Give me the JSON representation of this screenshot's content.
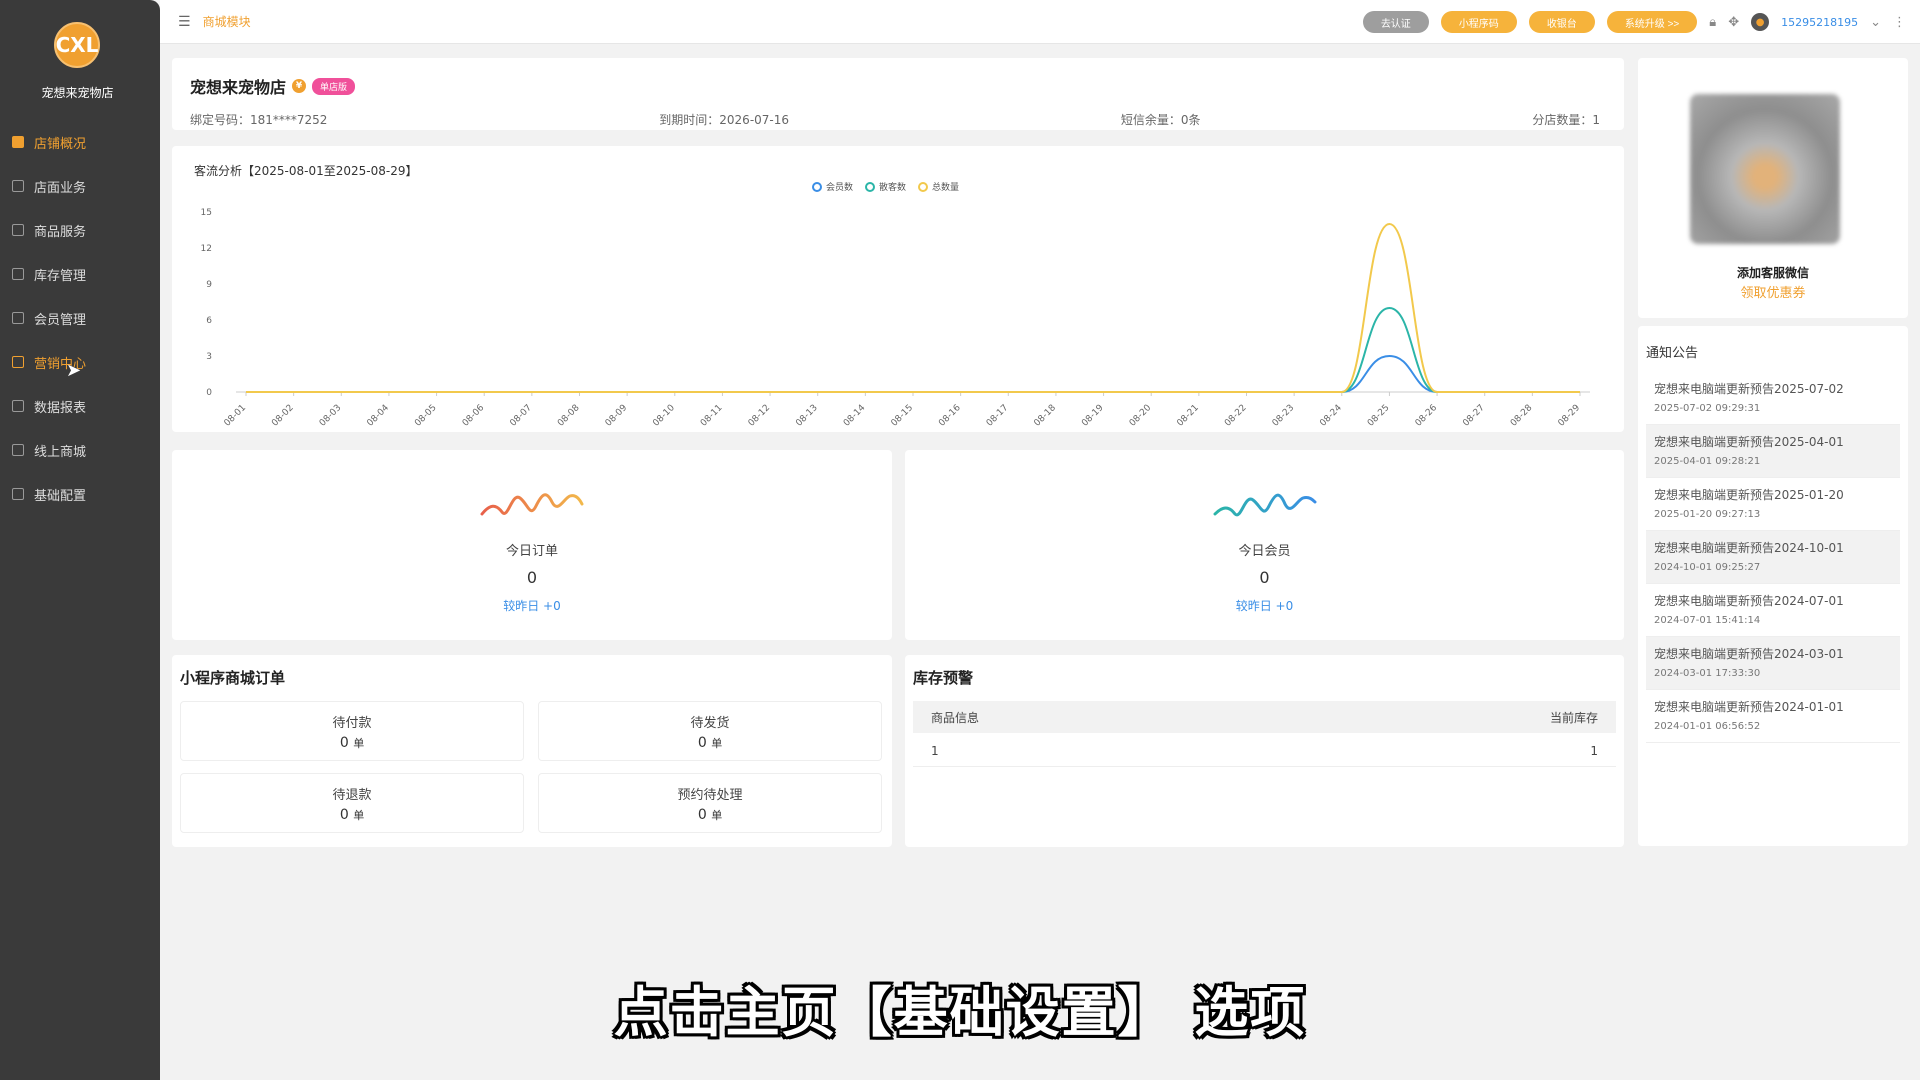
{
  "sidebar": {
    "logo_text": "CXL",
    "store_name": "宠想来宠物店",
    "items": [
      {
        "label": "店铺概况",
        "icon": "store-icon"
      },
      {
        "label": "店面业务",
        "icon": "shop-icon"
      },
      {
        "label": "商品服务",
        "icon": "goods-icon"
      },
      {
        "label": "库存管理",
        "icon": "inventory-icon"
      },
      {
        "label": "会员管理",
        "icon": "member-icon"
      },
      {
        "label": "营销中心",
        "icon": "marketing-icon"
      },
      {
        "label": "数据报表",
        "icon": "report-icon"
      },
      {
        "label": "线上商城",
        "icon": "mall-icon"
      },
      {
        "label": "基础配置",
        "icon": "config-icon"
      }
    ],
    "active_index": 0,
    "hover_index": 5
  },
  "topbar": {
    "module_link": "商城模块",
    "buttons": [
      "去认证",
      "小程序码",
      "收银台",
      "系统升级 >>"
    ],
    "phone": "15295218195"
  },
  "store": {
    "name": "宠想来宠物店",
    "badge": "单店版",
    "bind_phone": "绑定号码：181****7252",
    "expire": "到期时间：2026-07-16",
    "sms": "短信余量：0条",
    "branches": "分店数量：1"
  },
  "chart_data": {
    "type": "line",
    "title": "客流分析【2025-08-01至2025-08-29】",
    "categories": [
      "08-01",
      "08-02",
      "08-03",
      "08-04",
      "08-05",
      "08-06",
      "08-07",
      "08-08",
      "08-09",
      "08-10",
      "08-11",
      "08-12",
      "08-13",
      "08-14",
      "08-15",
      "08-16",
      "08-17",
      "08-18",
      "08-19",
      "08-20",
      "08-21",
      "08-22",
      "08-23",
      "08-24",
      "08-25",
      "08-26",
      "08-27",
      "08-28",
      "08-29"
    ],
    "series": [
      {
        "name": "会员数",
        "color": "#3a8ee6",
        "values": [
          0,
          0,
          0,
          0,
          0,
          0,
          0,
          0,
          0,
          0,
          0,
          0,
          0,
          0,
          0,
          0,
          0,
          0,
          0,
          0,
          0,
          0,
          0,
          0,
          3,
          0,
          0,
          0,
          0
        ]
      },
      {
        "name": "散客数",
        "color": "#2bb5a8",
        "values": [
          0,
          0,
          0,
          0,
          0,
          0,
          0,
          0,
          0,
          0,
          0,
          0,
          0,
          0,
          0,
          0,
          0,
          0,
          0,
          0,
          0,
          0,
          0,
          0,
          7,
          0,
          0,
          0,
          0
        ]
      },
      {
        "name": "总数量",
        "color": "#f2c94c",
        "values": [
          0,
          0,
          0,
          0,
          0,
          0,
          0,
          0,
          0,
          0,
          0,
          0,
          0,
          0,
          0,
          0,
          0,
          0,
          0,
          0,
          0,
          0,
          0,
          0,
          14,
          0,
          0,
          0,
          0
        ]
      }
    ],
    "y_ticks": [
      "0",
      "3",
      "6",
      "9",
      "12",
      "15"
    ],
    "ylim": [
      0,
      15
    ],
    "grid": false,
    "legend": "top-center"
  },
  "today_orders": {
    "label": "今日订单",
    "value": "0",
    "delta": "较昨日 +0",
    "color": "#e8604a"
  },
  "today_members": {
    "label": "今日会员",
    "value": "0",
    "delta": "较昨日 +0",
    "color": "#2bb5a8"
  },
  "mini_orders": {
    "title": "小程序商城订单",
    "unit": "单",
    "cells": [
      {
        "label": "待付款",
        "value": "0"
      },
      {
        "label": "待发货",
        "value": "0"
      },
      {
        "label": "待退款",
        "value": "0"
      },
      {
        "label": "预约待处理",
        "value": "0"
      }
    ]
  },
  "stock": {
    "title": "库存预警",
    "columns": [
      "商品信息",
      "当前库存"
    ],
    "rows": [
      [
        "1",
        "1"
      ]
    ]
  },
  "wechat": {
    "title": "添加客服微信",
    "link": "领取优惠券"
  },
  "notices": {
    "title": "通知公告",
    "items": [
      {
        "title": "宠想来电脑端更新预告2025-07-02",
        "date": "2025-07-02 09:29:31"
      },
      {
        "title": "宠想来电脑端更新预告2025-04-01",
        "date": "2025-04-01 09:28:21"
      },
      {
        "title": "宠想来电脑端更新预告2025-01-20",
        "date": "2025-01-20 09:27:13"
      },
      {
        "title": "宠想来电脑端更新预告2024-10-01",
        "date": "2024-10-01 09:25:27"
      },
      {
        "title": "宠想来电脑端更新预告2024-07-01",
        "date": "2024-07-01 15:41:14"
      },
      {
        "title": "宠想来电脑端更新预告2024-03-01",
        "date": "2024-03-01 17:33:30"
      },
      {
        "title": "宠想来电脑端更新预告2024-01-01",
        "date": "2024-01-01 06:56:52"
      }
    ]
  },
  "subtitle": "点击主页【基础设置】 选项"
}
